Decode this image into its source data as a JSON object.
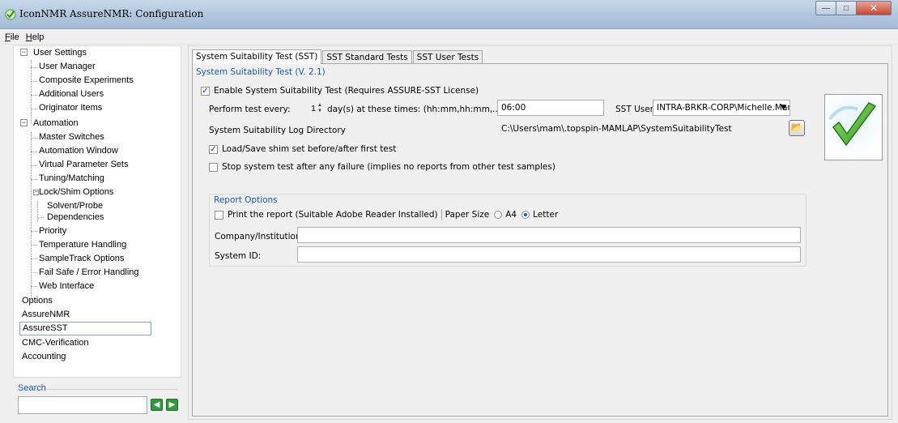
{
  "window": {
    "title": "IconNMR AssureNMR: Configuration",
    "min_glyph": "—",
    "max_glyph": "□",
    "close_glyph": "✕"
  },
  "menu": {
    "file": "File",
    "help": "Help"
  },
  "tree": {
    "user_settings": "User Settings",
    "user_manager": "User Manager",
    "composite_experiments": "Composite Experiments",
    "additional_users": "Additional Users",
    "originator_items": "Originator Items",
    "automation": "Automation",
    "master_switches": "Master Switches",
    "automation_window": "Automation Window",
    "virtual_parameter_sets": "Virtual Parameter Sets",
    "tuning_matching": "Tuning/Matching",
    "lock_shim_options": "Lock/Shim Options",
    "solvent_probe_1": "Solvent/Probe",
    "solvent_probe_2": "Dependencies",
    "priority": "Priority",
    "temperature_handling": "Temperature Handling",
    "sampletrack_options": "SampleTrack Options",
    "fail_safe": "Fail Safe / Error Handling",
    "web_interface": "Web Interface",
    "options": "Options",
    "assurenmr": "AssureNMR",
    "assuresst": "AssureSST",
    "cmc_verification": "CMC-Verification",
    "accounting": "Accounting",
    "minus_glyph": "−"
  },
  "search": {
    "label": "Search",
    "value": "",
    "back_glyph": "◀",
    "forward_glyph": "▶"
  },
  "tabs": {
    "sst": "System Suitability Test (SST)",
    "standard": "SST Standard Tests",
    "user": "SST User Tests"
  },
  "sst": {
    "section_title": "System Suitability Test (V. 2.1)",
    "enable_label": "Enable System Suitability Test (Requires ASSURE-SST License)",
    "enable_checked": true,
    "perform_label": "Perform test every:",
    "every_value": "1",
    "days_label": "day(s) at these times: (hh:mm,hh:mm,...)",
    "times_value": "06:00",
    "user_label": "SST User",
    "user_value": "INTRA-BRKR-CORP\\Michelle.Mark",
    "log_dir_label": "System Suitability Log Directory",
    "log_dir_value": "C:\\Users\\mam\\.topspin-MAMLAP\\SystemSuitabilityTest",
    "load_shim_label": "Load/Save shim set before/after first test",
    "load_shim_checked": true,
    "stop_label": "Stop system test after any failure (implies no reports from other test samples)",
    "stop_checked": false,
    "check_glyph": "✓",
    "spin_up": "▲",
    "spin_down": "▼",
    "dropdown_glyph": "▼",
    "folder_glyph": "📂"
  },
  "report": {
    "title": "Report Options",
    "print_label": "Print the report (Suitable Adobe Reader Installed)",
    "print_checked": false,
    "paper_label": "Paper Size",
    "a4": "A4",
    "letter": "Letter",
    "selected_paper": "Letter",
    "company_label": "Company/Institution:",
    "company_value": "",
    "system_label": "System ID:",
    "system_value": ""
  },
  "colors": {
    "accent_blue": "#1a57b7",
    "check_green": "#3aaa2c",
    "titlebar": "#b4c9e0"
  }
}
